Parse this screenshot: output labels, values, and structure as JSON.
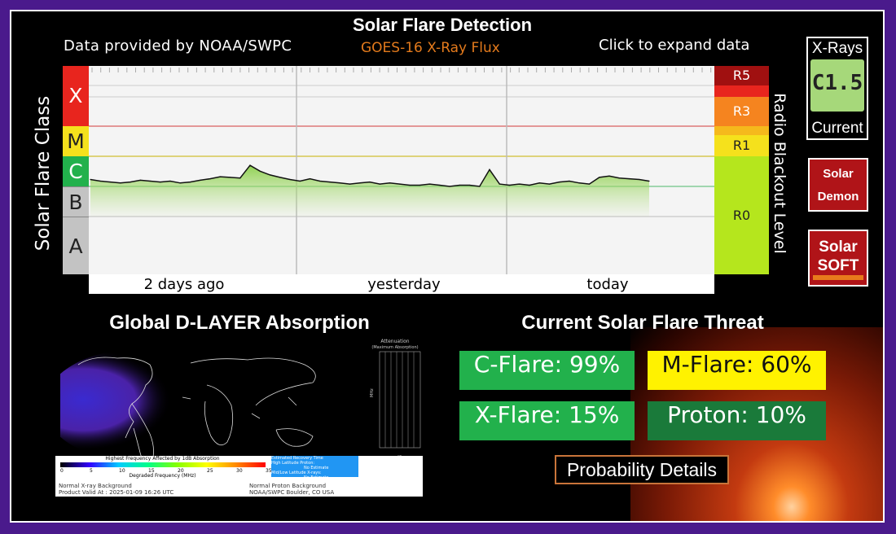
{
  "header": {
    "title": "Solar Flare Detection",
    "provider": "Data provided by NOAA/SWPC",
    "subtitle": "GOES-16 X-Ray Flux",
    "expand": "Click to expand data"
  },
  "chart": {
    "y_label": "Solar Flare Class",
    "y2_label": "Radio Blackout Level",
    "classes": [
      "X",
      "M",
      "C",
      "B",
      "A"
    ],
    "radio_levels": [
      "R5",
      "R3",
      "R1",
      "R0"
    ],
    "x_ticks": [
      "2 days ago",
      "yesterday",
      "today"
    ]
  },
  "chart_data": {
    "type": "line",
    "title": "Solar Flare Detection",
    "xlabel": "",
    "ylabel": "Solar Flare Class",
    "y_scale": "log",
    "x_categories": [
      "2 days ago",
      "yesterday",
      "today"
    ],
    "series": [
      {
        "name": "GOES-16 X-Ray Flux",
        "flare_class": [
          "C1.7",
          "C1.5",
          "C1.4",
          "C1.3",
          "C1.4",
          "C1.6",
          "C1.5",
          "C1.4",
          "C1.5",
          "C1.3",
          "C1.4",
          "C1.6",
          "C1.8",
          "C2.1",
          "C2.0",
          "C1.9",
          "C5.0",
          "C3.2",
          "C2.4",
          "C2.0",
          "C1.7",
          "C1.5",
          "C1.8",
          "C1.5",
          "C1.4",
          "C1.3",
          "C1.2",
          "C1.3",
          "C1.4",
          "C1.2",
          "C1.3",
          "C1.2",
          "C1.1",
          "C1.1",
          "C1.2",
          "C1.1",
          "C1.0",
          "C1.1",
          "C1.1",
          "C1.0",
          "C3.6",
          "C1.2",
          "C1.1",
          "C1.2",
          "C1.1",
          "C1.3",
          "C1.2",
          "C1.4",
          "C1.5",
          "C1.3",
          "C1.2",
          "C2.0",
          "C2.2",
          "C1.9",
          "C1.8",
          "C1.7",
          "C1.5"
        ]
      }
    ]
  },
  "xray": {
    "label": "X-Rays",
    "value": "C1.5",
    "current": "Current"
  },
  "buttons": {
    "demon_l1": "Solar",
    "demon_l2": "Demon",
    "soft_l1": "Solar",
    "soft_l2": "SOFT"
  },
  "dlayer": {
    "title": "Global D-LAYER Absorption",
    "attenuation_title": "Attenuation",
    "attenuation_sub": "(Maximum Absorption)",
    "legend_title": "Highest Frequency Affected by 1dB Absorption",
    "legend_axis": "Degraded Frequency (MHz)",
    "legend_ticks": [
      "0",
      "5",
      "10",
      "15",
      "20",
      "25",
      "30",
      "35"
    ],
    "recovery_title": "Estimated Recovery Time",
    "recovery_high": "High Latitude Proton:",
    "recovery_high_val": "No Estimate",
    "recovery_mid": "Mid/Low Latitude X-rays:",
    "recovery_mid_val": "No Estimate",
    "footer_xray": "Normal X-ray Background",
    "footer_proton": "Normal Proton Background",
    "footer_valid": "Product Valid At : 2025-01-09 16:26 UTC",
    "footer_source": "NOAA/SWPC Boulder, CO USA",
    "db_label": "dB",
    "mhz_label": "MHz"
  },
  "threat": {
    "title": "Current Solar Flare Threat",
    "c_flare": "C-Flare: 99%",
    "m_flare": "M-Flare: 60%",
    "x_flare": "X-Flare: 15%",
    "proton": "Proton: 10%",
    "details": "Probability Details"
  },
  "colors": {
    "frame": "#4a1a8c",
    "class_x": "#e8251e",
    "class_m": "#f5e11c",
    "class_c": "#22b14c",
    "class_b": "#c3c3c3",
    "class_a": "#c3c3c3",
    "r5": "#a01010",
    "r3": "#f5841f",
    "r1": "#f5e11c",
    "r0": "#b5e61d",
    "threat_c": "#22b14c",
    "threat_m": "#fff200",
    "threat_x": "#22b14c",
    "threat_proton": "#1a7a3a"
  }
}
